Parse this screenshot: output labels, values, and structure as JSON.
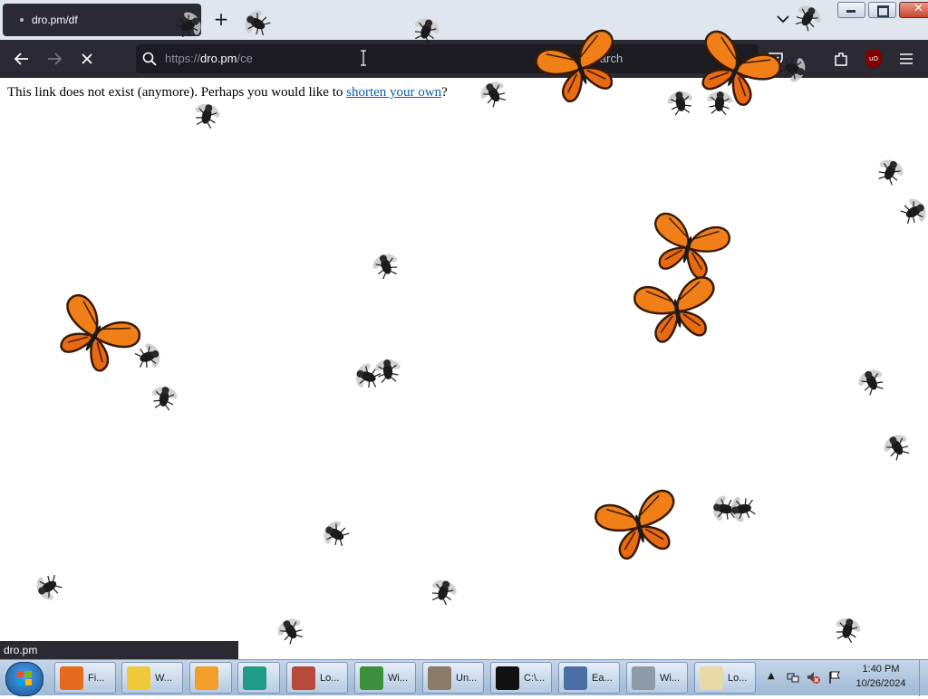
{
  "browser": {
    "tab": {
      "title": "dro.pm/df"
    },
    "url": {
      "scheme": "https://",
      "host": "dro.pm",
      "path": "/ce"
    },
    "search_placeholder": "Search",
    "ublock_label": "uO"
  },
  "page": {
    "message_text": "This link does not exist (anymore). Perhaps you would like to ",
    "link_text": "shorten your own",
    "message_suffix": "?",
    "status_text": "dro.pm"
  },
  "taskbar": {
    "items": [
      {
        "label": "Fi...",
        "icon": "firefox-icon",
        "color": "#e66a1e"
      },
      {
        "label": "W...",
        "icon": "folder-icon",
        "color": "#f0c93a"
      },
      {
        "label": "",
        "icon": "media-player-icon",
        "color": "#f29e2b"
      },
      {
        "label": "",
        "icon": "teal-app-icon",
        "color": "#1f9c87"
      },
      {
        "label": "Lo...",
        "icon": "app-icon",
        "color": "#b84a3c"
      },
      {
        "label": "Wi...",
        "icon": "monitor-icon",
        "color": "#3c8f3c"
      },
      {
        "label": "Un...",
        "icon": "tools-icon",
        "color": "#8a7a6a"
      },
      {
        "label": "C:\\...",
        "icon": "7zip-icon",
        "color": "#111111"
      },
      {
        "label": "Ea...",
        "icon": "computer-icon",
        "color": "#4a6fa5"
      },
      {
        "label": "Wi...",
        "icon": "scanner-icon",
        "color": "#8e9aa8"
      },
      {
        "label": "Lo...",
        "icon": "notepad-icon",
        "color": "#e8d9a8"
      }
    ],
    "clock_time": "1:40 PM",
    "clock_date": "10/26/2024"
  }
}
